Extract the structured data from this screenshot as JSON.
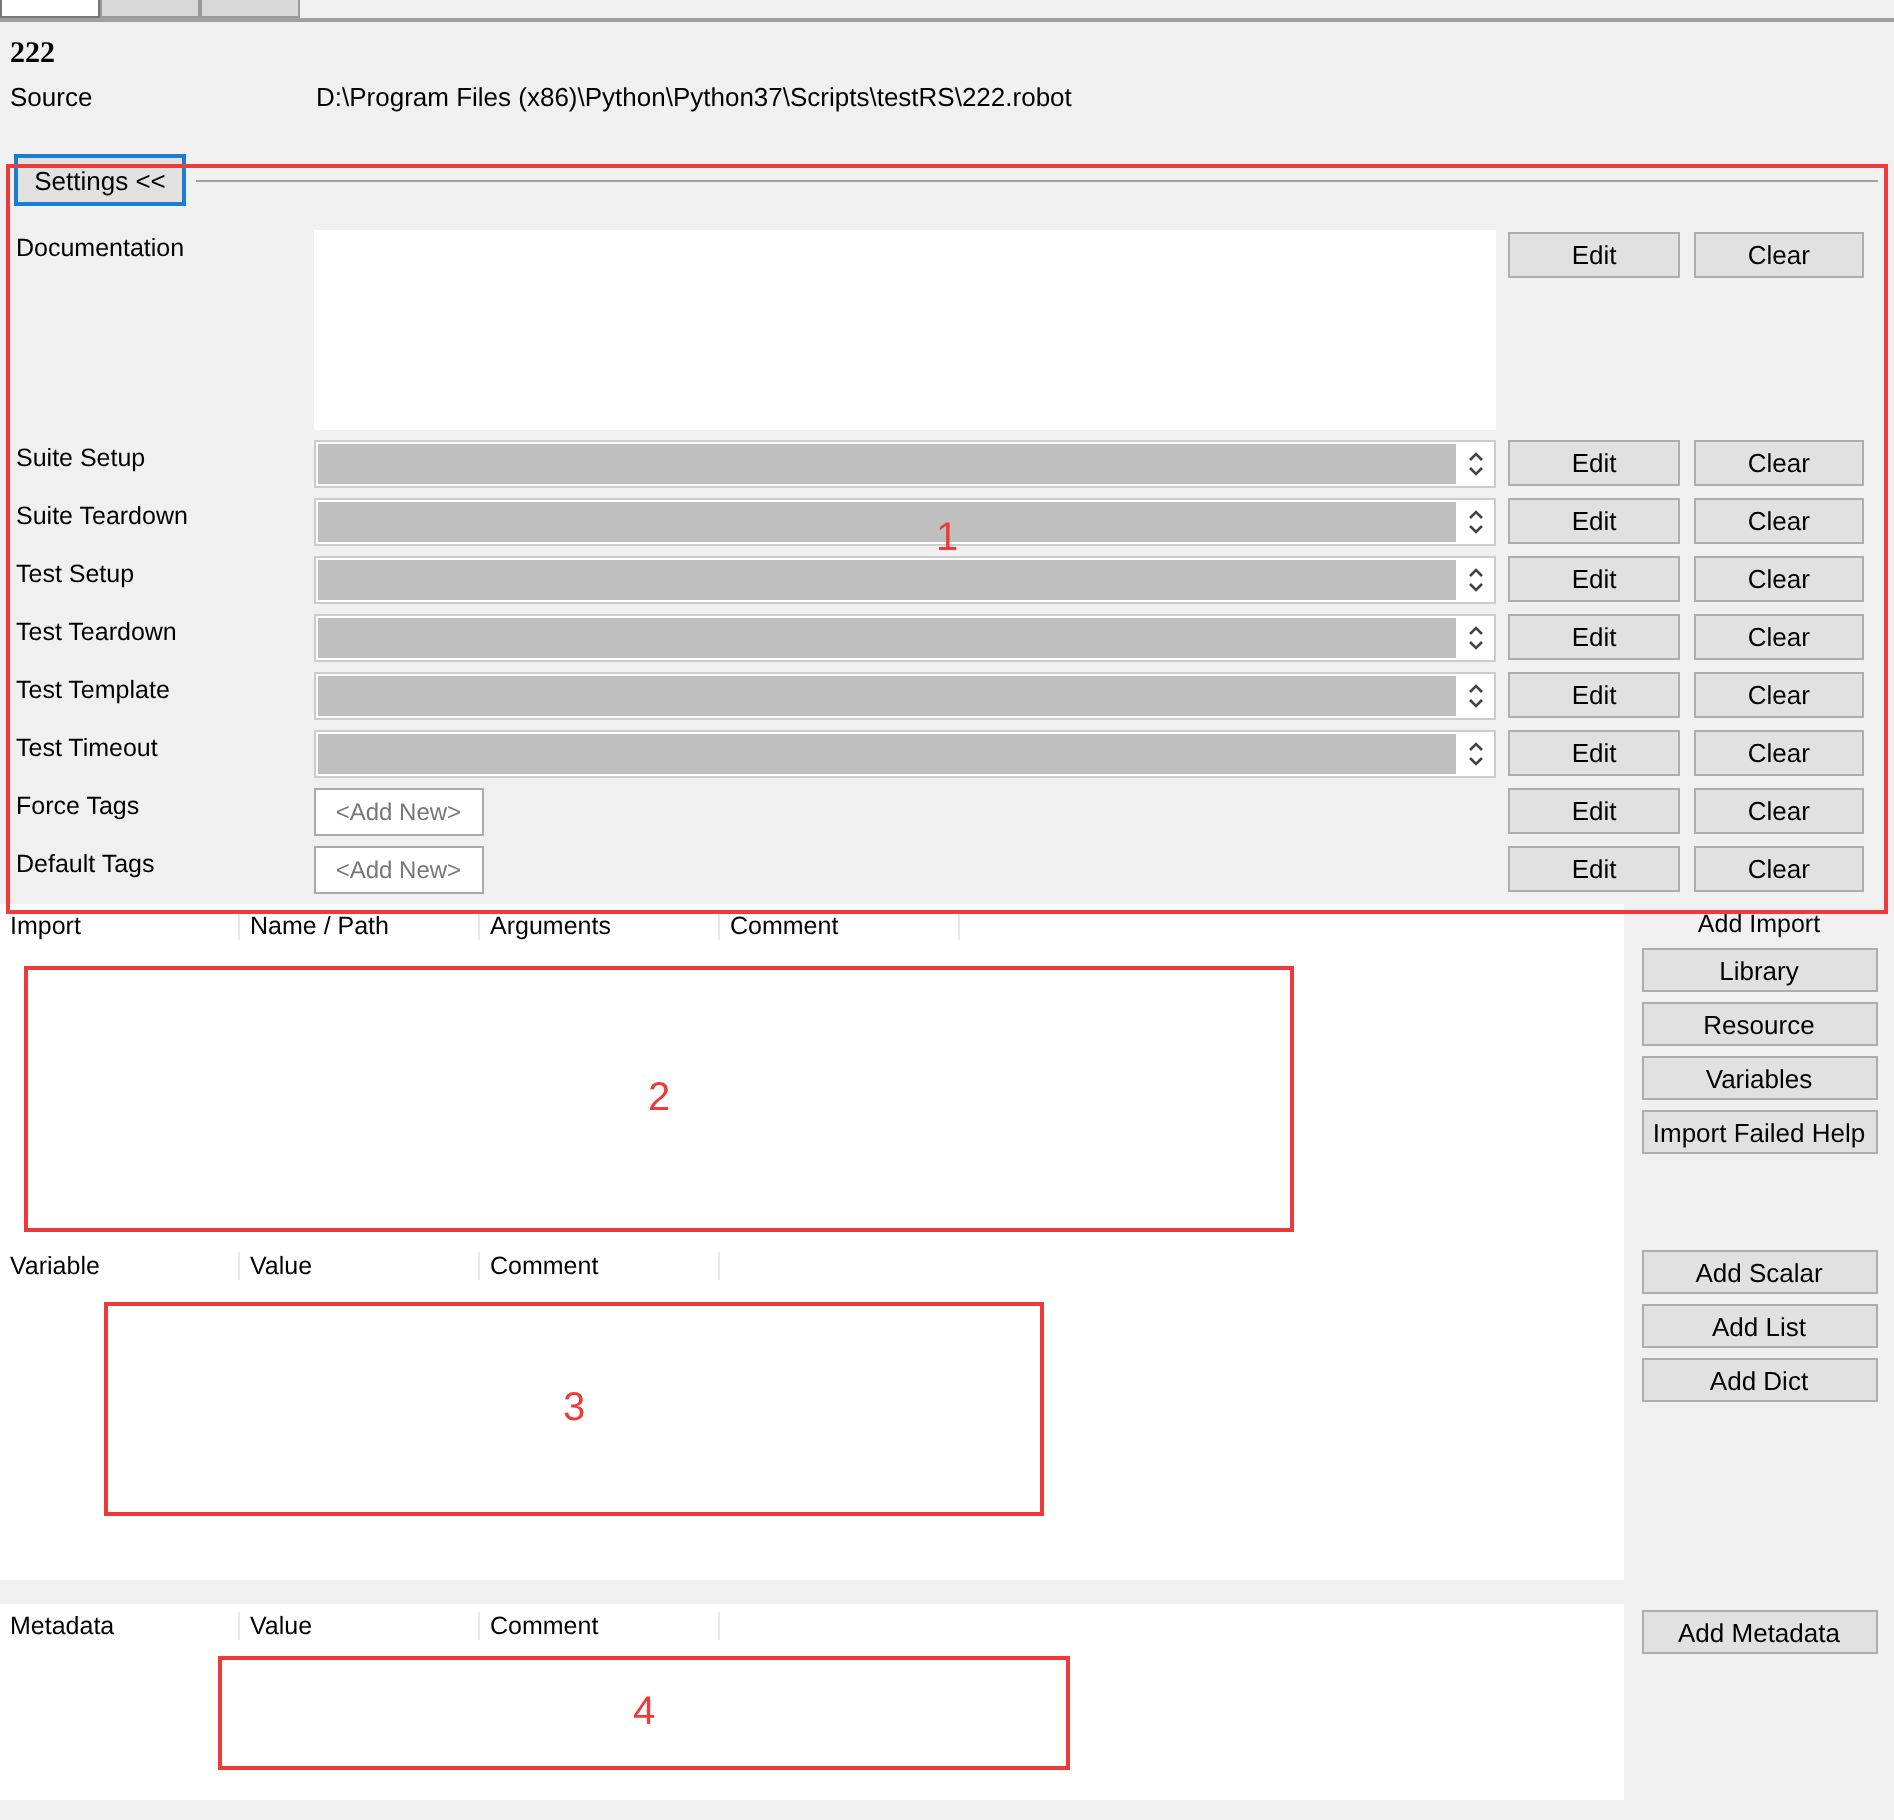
{
  "tabs": [
    {
      "selected": true
    },
    {
      "selected": false
    },
    {
      "selected": false
    }
  ],
  "suite": {
    "name": "222",
    "source_label": "Source",
    "source_path": "D:\\Program Files (x86)\\Python\\Python37\\Scripts\\testRS\\222.robot"
  },
  "settings": {
    "toggle": "Settings <<",
    "rows": [
      {
        "kind": "doc",
        "label": "Documentation",
        "edit": "Edit",
        "clear": "Clear"
      },
      {
        "kind": "combo",
        "label": "Suite Setup",
        "edit": "Edit",
        "clear": "Clear"
      },
      {
        "kind": "combo",
        "label": "Suite Teardown",
        "edit": "Edit",
        "clear": "Clear"
      },
      {
        "kind": "combo",
        "label": "Test Setup",
        "edit": "Edit",
        "clear": "Clear"
      },
      {
        "kind": "combo",
        "label": "Test Teardown",
        "edit": "Edit",
        "clear": "Clear"
      },
      {
        "kind": "combo",
        "label": "Test Template",
        "edit": "Edit",
        "clear": "Clear"
      },
      {
        "kind": "combo",
        "label": "Test Timeout",
        "edit": "Edit",
        "clear": "Clear"
      },
      {
        "kind": "tags",
        "label": "Force Tags",
        "placeholder": "<Add New>",
        "edit": "Edit",
        "clear": "Clear"
      },
      {
        "kind": "tags",
        "label": "Default Tags",
        "placeholder": "<Add New>",
        "edit": "Edit",
        "clear": "Clear"
      }
    ]
  },
  "sections": [
    {
      "columns": [
        "Import",
        "Name / Path",
        "Arguments",
        "Comment"
      ],
      "heading": "Add Import",
      "buttons": [
        "Library",
        "Resource",
        "Variables",
        "Import Failed Help"
      ]
    },
    {
      "columns": [
        "Variable",
        "Value",
        "Comment"
      ],
      "buttons": [
        "Add Scalar",
        "Add List",
        "Add Dict"
      ]
    },
    {
      "columns": [
        "Metadata",
        "Value",
        "Comment"
      ],
      "buttons": [
        "Add Metadata"
      ]
    }
  ],
  "annotations": [
    {
      "label": "1"
    },
    {
      "label": "2"
    },
    {
      "label": "3"
    },
    {
      "label": "4"
    }
  ]
}
